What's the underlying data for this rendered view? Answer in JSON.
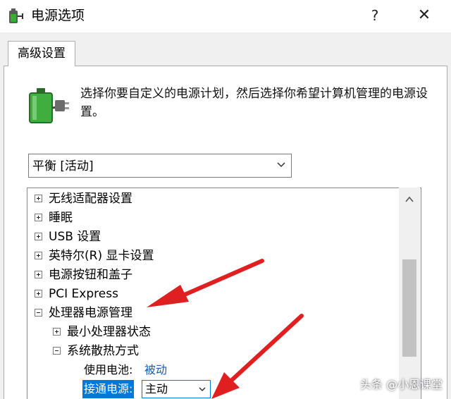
{
  "window": {
    "title": "电源选项",
    "help_glyph": "?",
    "close_glyph": "✕"
  },
  "tab": {
    "label": "高级设置"
  },
  "description": "选择你要自定义的电源计划，然后选择你希望计算机管理的电源设置。",
  "plan_dropdown": {
    "selected": "平衡 [活动]"
  },
  "tree": {
    "items": [
      {
        "label": "无线适配器设置",
        "expander": "plus"
      },
      {
        "label": "睡眠",
        "expander": "plus"
      },
      {
        "label": "USB 设置",
        "expander": "plus"
      },
      {
        "label": "英特尔(R) 显卡设置",
        "expander": "plus"
      },
      {
        "label": "电源按钮和盖子",
        "expander": "plus"
      },
      {
        "label": "PCI Express",
        "expander": "plus"
      },
      {
        "label": "处理器电源管理",
        "expander": "minus"
      }
    ],
    "children": [
      {
        "label": "最小处理器状态",
        "expander": "plus"
      },
      {
        "label": "系统散热方式",
        "expander": "minus"
      }
    ],
    "settings": {
      "battery_label": "使用电池:",
      "battery_value": "被动",
      "plugged_label": "接通电源:",
      "plugged_value": "主动"
    }
  },
  "watermark": "头条 @小恩课堂",
  "colors": {
    "selection": "#0078d7",
    "link_value": "#1a5aa8",
    "annotation_arrow": "#e02020",
    "dialog_background": "#f0f0f0"
  },
  "icons": {
    "title": "power-options-icon",
    "header": "battery-plug-icon"
  }
}
